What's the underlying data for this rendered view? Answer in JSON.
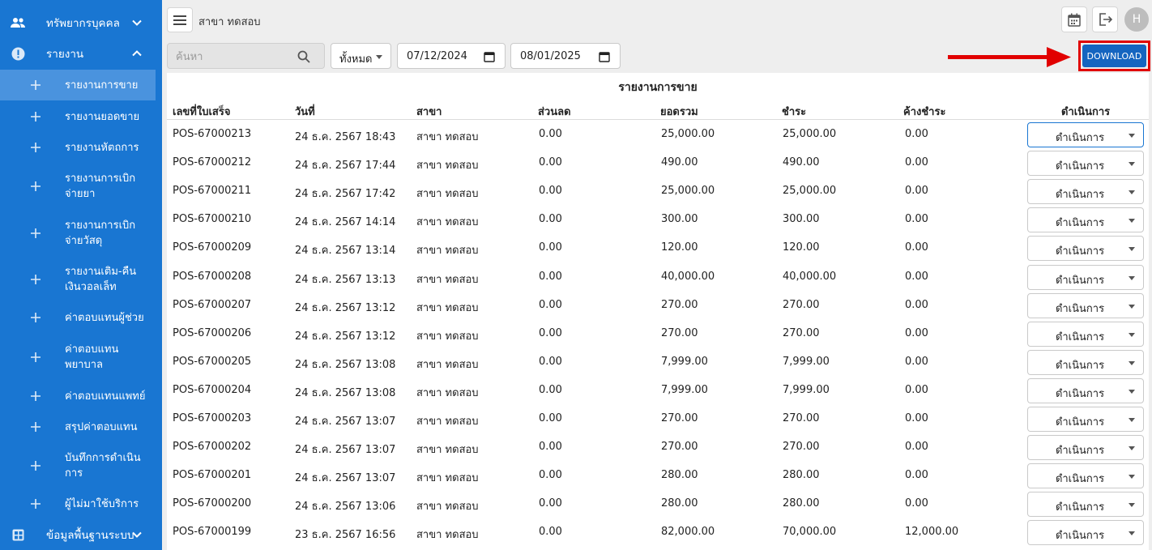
{
  "sidebar": {
    "groups": [
      {
        "label": "ทรัพยากรบุคคล",
        "icon": "people-icon",
        "expanded": false
      },
      {
        "label": "รายงาน",
        "icon": "info-circle-icon",
        "expanded": true
      },
      {
        "label": "ข้อมูลพื้นฐานระบบ",
        "icon": "grid-icon",
        "expanded": false
      }
    ],
    "report_items": [
      {
        "label": "รายงานการขาย",
        "active": true
      },
      {
        "label": "รายงานยอดขาย"
      },
      {
        "label": "รายงานหัตถการ"
      },
      {
        "label": "รายงานการเบิกจ่ายยา"
      },
      {
        "label": "รายงานการเบิกจ่ายวัสดุ"
      },
      {
        "label": "รายงานเติม-คืนเงินวอลเล็ท"
      },
      {
        "label": "ค่าตอบแทนผู้ช่วย"
      },
      {
        "label": "ค่าตอบแทนพยาบาล"
      },
      {
        "label": "ค่าตอบแทนแพทย์"
      },
      {
        "label": "สรุปค่าตอบแทน"
      },
      {
        "label": "บันทึกการดำเนินการ"
      },
      {
        "label": "ผู้ไม่มาใช้บริการ"
      }
    ]
  },
  "header": {
    "branch": "สาขา ทดสอบ",
    "avatar_initial": "H",
    "icons": [
      "menu-icon",
      "calendar-icon",
      "logout-icon"
    ]
  },
  "filters": {
    "search_placeholder": "ค้นหา",
    "select_value": "ทั้งหมด",
    "date_from": "07/12/2024",
    "date_to": "08/01/2025",
    "download_label": "DOWNLOAD"
  },
  "colors": {
    "sidebar": "#1976d2",
    "download": "#1565c0",
    "highlight": "#e10000"
  },
  "report": {
    "title": "รายงานการขาย",
    "columns": [
      "เลขที่ใบเสร็จ",
      "วันที่",
      "สาขา",
      "ส่วนลด",
      "ยอดรวม",
      "ชำระ",
      "ค้างชำระ",
      "ดำเนินการ"
    ],
    "action_label": "ดำเนินการ",
    "rows": [
      [
        "POS-67000213",
        "24 ธ.ค. 2567 18:43",
        "สาขา ทดสอบ",
        "0.00",
        "25,000.00",
        "25,000.00",
        "0.00"
      ],
      [
        "POS-67000212",
        "24 ธ.ค. 2567 17:44",
        "สาขา ทดสอบ",
        "0.00",
        "490.00",
        "490.00",
        "0.00"
      ],
      [
        "POS-67000211",
        "24 ธ.ค. 2567 17:42",
        "สาขา ทดสอบ",
        "0.00",
        "25,000.00",
        "25,000.00",
        "0.00"
      ],
      [
        "POS-67000210",
        "24 ธ.ค. 2567 14:14",
        "สาขา ทดสอบ",
        "0.00",
        "300.00",
        "300.00",
        "0.00"
      ],
      [
        "POS-67000209",
        "24 ธ.ค. 2567 13:14",
        "สาขา ทดสอบ",
        "0.00",
        "120.00",
        "120.00",
        "0.00"
      ],
      [
        "POS-67000208",
        "24 ธ.ค. 2567 13:13",
        "สาขา ทดสอบ",
        "0.00",
        "40,000.00",
        "40,000.00",
        "0.00"
      ],
      [
        "POS-67000207",
        "24 ธ.ค. 2567 13:12",
        "สาขา ทดสอบ",
        "0.00",
        "270.00",
        "270.00",
        "0.00"
      ],
      [
        "POS-67000206",
        "24 ธ.ค. 2567 13:12",
        "สาขา ทดสอบ",
        "0.00",
        "270.00",
        "270.00",
        "0.00"
      ],
      [
        "POS-67000205",
        "24 ธ.ค. 2567 13:08",
        "สาขา ทดสอบ",
        "0.00",
        "7,999.00",
        "7,999.00",
        "0.00"
      ],
      [
        "POS-67000204",
        "24 ธ.ค. 2567 13:08",
        "สาขา ทดสอบ",
        "0.00",
        "7,999.00",
        "7,999.00",
        "0.00"
      ],
      [
        "POS-67000203",
        "24 ธ.ค. 2567 13:07",
        "สาขา ทดสอบ",
        "0.00",
        "270.00",
        "270.00",
        "0.00"
      ],
      [
        "POS-67000202",
        "24 ธ.ค. 2567 13:07",
        "สาขา ทดสอบ",
        "0.00",
        "270.00",
        "270.00",
        "0.00"
      ],
      [
        "POS-67000201",
        "24 ธ.ค. 2567 13:07",
        "สาขา ทดสอบ",
        "0.00",
        "280.00",
        "280.00",
        "0.00"
      ],
      [
        "POS-67000200",
        "24 ธ.ค. 2567 13:06",
        "สาขา ทดสอบ",
        "0.00",
        "280.00",
        "280.00",
        "0.00"
      ],
      [
        "POS-67000199",
        "23 ธ.ค. 2567 16:56",
        "สาขา ทดสอบ",
        "0.00",
        "82,000.00",
        "70,000.00",
        "12,000.00"
      ]
    ]
  }
}
